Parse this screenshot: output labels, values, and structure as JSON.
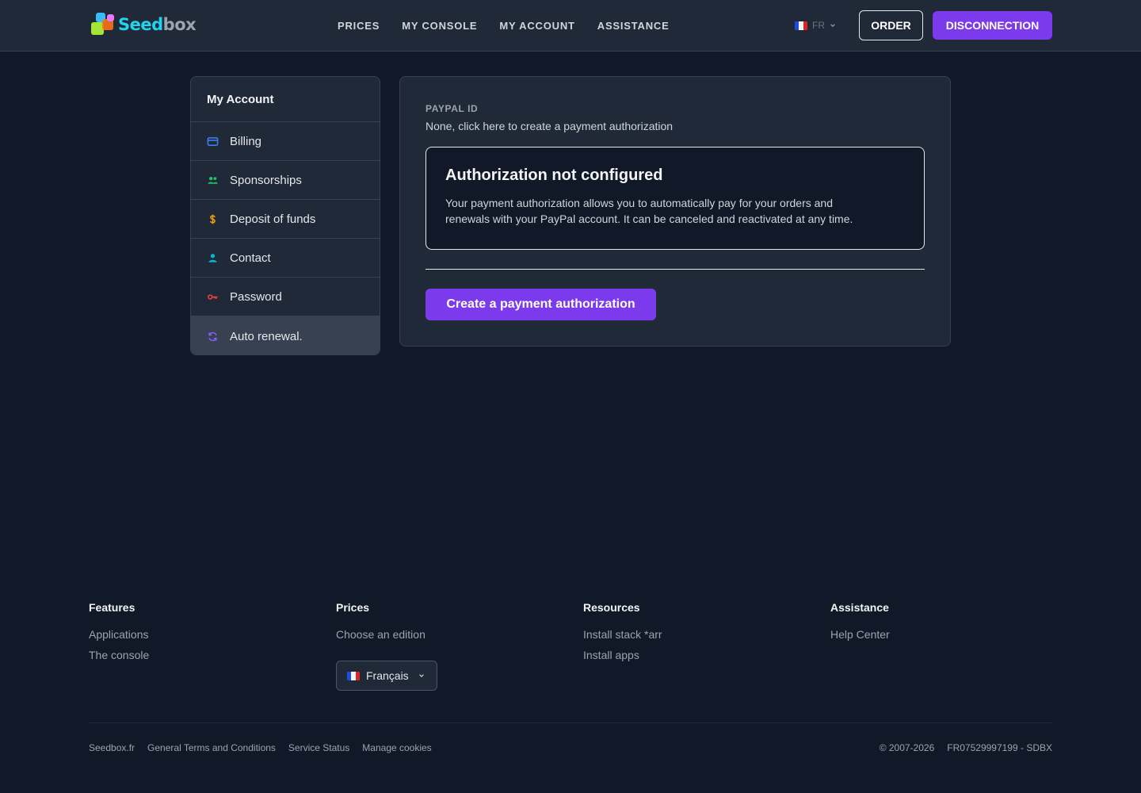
{
  "header": {
    "logo": {
      "word_part_1": "Seed",
      "word_part_2": "box"
    },
    "nav": [
      {
        "label": "PRICES"
      },
      {
        "label": "MY CONSOLE"
      },
      {
        "label": "MY ACCOUNT"
      },
      {
        "label": "ASSISTANCE"
      }
    ],
    "language": {
      "code": "FR",
      "flag": "fr-flag-icon"
    },
    "order_label": "ORDER",
    "disconnect_label": "DISCONNECTION"
  },
  "sidebar": {
    "title": "My Account",
    "items": [
      {
        "label": "Billing",
        "icon": "credit-card-icon",
        "color": "#3b82f6"
      },
      {
        "label": "Sponsorships",
        "icon": "users-icon",
        "color": "#22c55e"
      },
      {
        "label": "Deposit of funds",
        "icon": "dollar-icon",
        "color": "#f59e0b"
      },
      {
        "label": "Contact",
        "icon": "user-icon",
        "color": "#06b6d4"
      },
      {
        "label": "Password",
        "icon": "key-icon",
        "color": "#ef4444"
      },
      {
        "label": "Auto renewal.",
        "icon": "refresh-icon",
        "color": "#8b5cf6",
        "active": true
      }
    ]
  },
  "main": {
    "paypal_label": "PAYPAL ID",
    "paypal_value": "None, click here to create a payment authorization",
    "notice_title": "Authorization not configured",
    "notice_text_line1": "Your payment authorization allows you to automatically pay for your orders and",
    "notice_text_line2": "renewals with your PayPal account. It can be canceled and reactivated at any time.",
    "create_button": "Create a payment authorization"
  },
  "footer": {
    "columns": [
      {
        "title": "Features",
        "links": [
          "Applications",
          "The console"
        ]
      },
      {
        "title": "Prices",
        "links": [
          "Choose an edition"
        ]
      },
      {
        "title": "Resources",
        "links": [
          "Install stack *arr",
          "Install apps"
        ]
      },
      {
        "title": "Assistance",
        "links": [
          "Help Center"
        ]
      }
    ],
    "language_select": "Français",
    "legal_links": [
      "Seedbox.fr",
      "General Terms and Conditions",
      "Service Status",
      "Manage cookies"
    ],
    "copyright": "© 2007-2026",
    "company_id": "FR07529997199 - SDBX"
  },
  "colors": {
    "accent": "#7c3aed",
    "background": "#111827",
    "surface": "#1f2937"
  }
}
